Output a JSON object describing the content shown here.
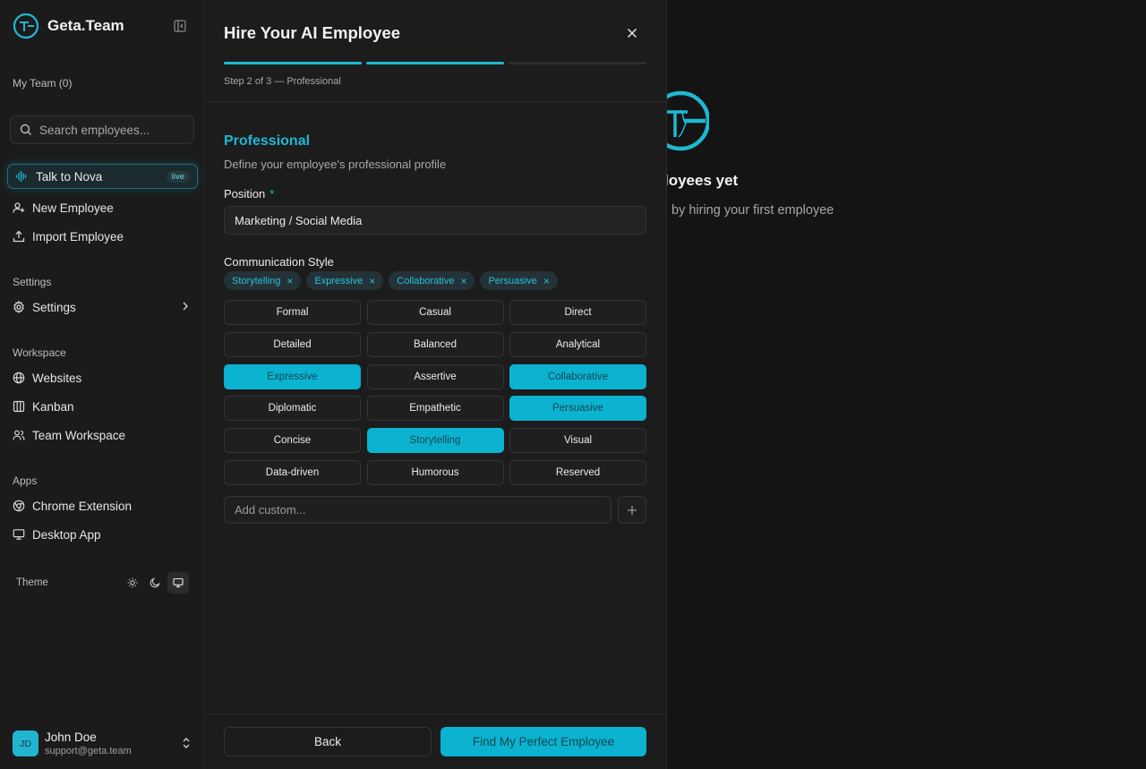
{
  "brand": {
    "name": "Geta.Team",
    "accent": "#1fb8d2"
  },
  "sidebar": {
    "team_label": "My Team (0)",
    "search_placeholder": "Search employees...",
    "nova": {
      "label": "Talk to Nova",
      "badge": "live"
    },
    "actions": [
      {
        "label": "New Employee",
        "icon": "user-plus-icon"
      },
      {
        "label": "Import Employee",
        "icon": "upload-icon"
      }
    ],
    "settings_section": "Settings",
    "settings_item": "Settings",
    "workspace_section": "Workspace",
    "workspace_items": [
      {
        "label": "Websites",
        "icon": "globe-icon"
      },
      {
        "label": "Kanban",
        "icon": "kanban-icon"
      },
      {
        "label": "Team Workspace",
        "icon": "users-icon"
      }
    ],
    "apps_section": "Apps",
    "apps_items": [
      {
        "label": "Chrome Extension",
        "icon": "chrome-icon"
      },
      {
        "label": "Desktop App",
        "icon": "monitor-icon"
      }
    ],
    "theme_label": "Theme",
    "user": {
      "initials": "JD",
      "name": "John Doe",
      "email": "support@geta.team"
    }
  },
  "background": {
    "title_partial": "loyees yet",
    "subtitle_partial": "by hiring your first employee"
  },
  "modal": {
    "title": "Hire Your AI Employee",
    "step_label": "Step 2 of 3 — Professional",
    "progress": {
      "current_step": 2,
      "total_steps": 3
    },
    "section_title": "Professional",
    "section_desc": "Define your employee's professional profile",
    "position_label": "Position",
    "required_mark": "*",
    "position_value": "Marketing / Social Media",
    "comm_label": "Communication Style",
    "selected_chips": [
      "Storytelling",
      "Expressive",
      "Collaborative",
      "Persuasive"
    ],
    "chip_remove_glyph": "×",
    "options": [
      {
        "label": "Formal",
        "selected": false
      },
      {
        "label": "Casual",
        "selected": false
      },
      {
        "label": "Direct",
        "selected": false
      },
      {
        "label": "Detailed",
        "selected": false
      },
      {
        "label": "Balanced",
        "selected": false
      },
      {
        "label": "Analytical",
        "selected": false
      },
      {
        "label": "Expressive",
        "selected": true
      },
      {
        "label": "Assertive",
        "selected": false
      },
      {
        "label": "Collaborative",
        "selected": true
      },
      {
        "label": "Diplomatic",
        "selected": false
      },
      {
        "label": "Empathetic",
        "selected": false
      },
      {
        "label": "Persuasive",
        "selected": true
      },
      {
        "label": "Concise",
        "selected": false
      },
      {
        "label": "Storytelling",
        "selected": true
      },
      {
        "label": "Visual",
        "selected": false
      },
      {
        "label": "Data-driven",
        "selected": false
      },
      {
        "label": "Humorous",
        "selected": false
      },
      {
        "label": "Reserved",
        "selected": false
      }
    ],
    "custom_placeholder": "Add custom...",
    "back_label": "Back",
    "find_label": "Find My Perfect Employee"
  }
}
